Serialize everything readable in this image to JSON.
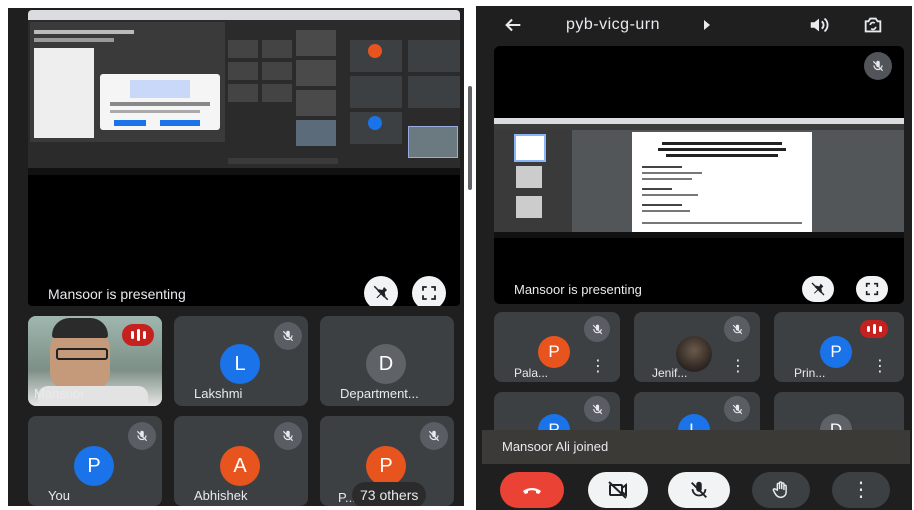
{
  "colors": {
    "background": "#202124",
    "tile": "#3c4043",
    "accent_blue": "#1a73e8",
    "avatar_orange": "#e8541e",
    "end_call_red": "#ea4335",
    "speaking_red": "#c5221f"
  },
  "left": {
    "presenting_text": "Mansoor is presenting",
    "tiles": [
      {
        "name": "Mansoor",
        "type": "video",
        "speaking": true
      },
      {
        "name": "Lakshmi",
        "initial": "L",
        "color": "#1a73e8",
        "muted": true
      },
      {
        "name": "Department...",
        "initial": "D",
        "color": "#5f6368",
        "muted": false
      },
      {
        "name": "You",
        "initial": "P",
        "color": "#1a73e8",
        "muted": true
      },
      {
        "name": "Abhishek",
        "initial": "A",
        "color": "#e8541e",
        "muted": true
      },
      {
        "name": "P...",
        "initial": "P",
        "color": "#e8541e",
        "muted": true,
        "overlay": "73 others"
      }
    ]
  },
  "right": {
    "meeting_code": "pyb-vicg-urn",
    "presenting_text": "Mansoor is presenting",
    "tiles": [
      {
        "name": "Pala...",
        "initial": "P",
        "color": "#e8541e",
        "muted": true
      },
      {
        "name": "Jenif...",
        "type": "photo",
        "muted": true
      },
      {
        "name": "Prin...",
        "initial": "P",
        "color": "#1a73e8",
        "speaking": true
      },
      {
        "name": "",
        "initial": "P",
        "color": "#1a73e8",
        "muted": true
      },
      {
        "name": "",
        "initial": "L",
        "color": "#1a73e8",
        "muted": true
      },
      {
        "name": "",
        "initial": "D",
        "color": "#5f6368",
        "muted": false
      }
    ],
    "toast": "Mansoor Ali joined"
  }
}
